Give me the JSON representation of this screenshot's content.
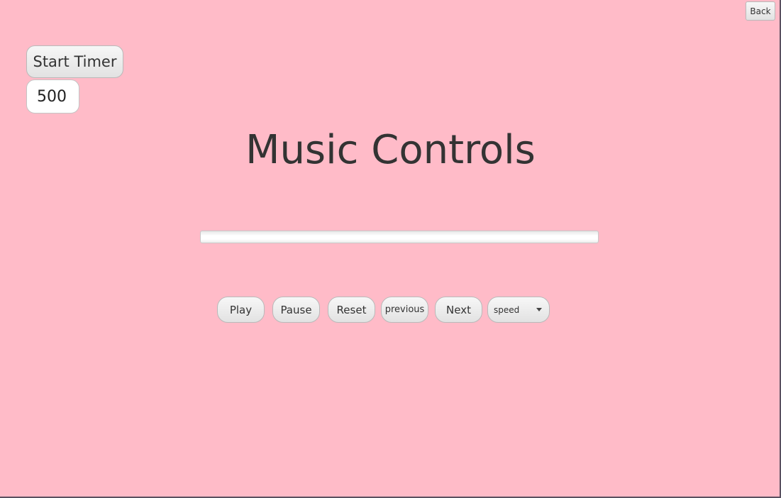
{
  "header": {
    "back_label": "Back"
  },
  "timer": {
    "start_label": "Start Timer",
    "value": "500"
  },
  "title": "Music Controls",
  "progress": {
    "fraction": 0
  },
  "controls": {
    "play_label": "Play",
    "pause_label": "Pause",
    "reset_label": "Reset",
    "previous_label": "previous",
    "next_label": "Next",
    "speed_selected": "speed"
  },
  "icons": {
    "speed_dropdown": "chevron-down-icon"
  },
  "colors": {
    "background": "#ffbbc8",
    "text": "#333333"
  }
}
